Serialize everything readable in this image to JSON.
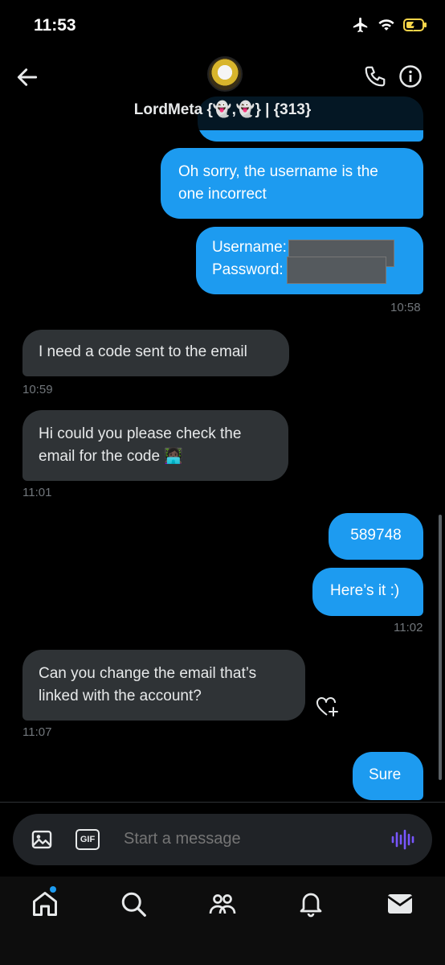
{
  "status_bar": {
    "time": "11:53",
    "icons": [
      "airplane-icon",
      "wifi-icon",
      "battery-charging-icon"
    ]
  },
  "header": {
    "contact_name": "LordMeta {👻,👻} | {313}",
    "icons": [
      "back-arrow-icon",
      "phone-icon",
      "info-icon"
    ]
  },
  "messages": [
    {
      "side": "out",
      "text": "Oh sorry, the username is the one incorrect"
    },
    {
      "side": "out",
      "username_label": "Username:",
      "password_label": "Password:",
      "timestamp": "10:58"
    },
    {
      "side": "in",
      "text": "I need a code sent to the email",
      "timestamp": "10:59"
    },
    {
      "side": "in",
      "text": "Hi could you please check the email for the code 👩🏿‍💻",
      "timestamp": "11:01"
    },
    {
      "side": "out",
      "text": "589748"
    },
    {
      "side": "out",
      "text": "Here’s it :)",
      "timestamp": "11:02"
    },
    {
      "side": "in",
      "text": "Can you change the email that’s linked with the account?",
      "timestamp": "11:07"
    },
    {
      "side": "out",
      "text": "Sure"
    }
  ],
  "composer": {
    "placeholder": "Start a message",
    "gif_label": "GIF"
  },
  "bottom_nav": {
    "items": [
      "home-icon",
      "search-icon",
      "communities-icon",
      "notifications-icon",
      "messages-icon"
    ]
  },
  "colors": {
    "accent": "#1d9bf0",
    "incoming_bubble": "#2f3336",
    "background": "#000000",
    "voice_icon": "#7856ff"
  }
}
